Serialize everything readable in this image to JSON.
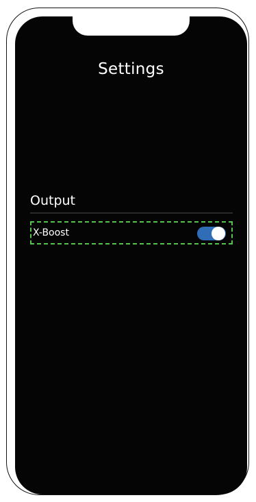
{
  "screen": {
    "title": "Settings"
  },
  "sections": [
    {
      "header": "Output",
      "items": [
        {
          "label": "X-Boost",
          "control": "toggle",
          "state": "on"
        }
      ]
    }
  ],
  "colors": {
    "screen_background": "#050505",
    "text": "#ffffff",
    "toggle_on": "#2f6db6",
    "highlight_border": "#5ac34f"
  }
}
